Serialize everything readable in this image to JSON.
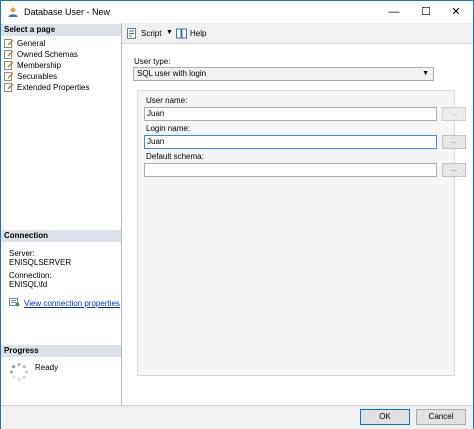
{
  "window": {
    "title": "Database User - New",
    "minimize_glyph": "—",
    "maximize_glyph": "☐",
    "close_glyph": "✕"
  },
  "toolbar": {
    "script_label": "Script",
    "help_label": "Help",
    "dropdown_glyph": "▼"
  },
  "left_pane": {
    "select_page_header": "Select a page",
    "pages": [
      {
        "label": "General",
        "icon": "page-wrench-icon"
      },
      {
        "label": "Owned Schemas",
        "icon": "page-wrench-icon"
      },
      {
        "label": "Membership",
        "icon": "page-wrench-icon"
      },
      {
        "label": "Securables",
        "icon": "page-wrench-icon"
      },
      {
        "label": "Extended Properties",
        "icon": "page-wrench-icon"
      }
    ],
    "connection_header": "Connection",
    "server_label": "Server:",
    "server_value": "ENISQLSERVER",
    "connection_label": "Connection:",
    "connection_value": "ENISQL\\fd",
    "view_connection_link": "View connection properties",
    "progress_header": "Progress",
    "progress_status": "Ready"
  },
  "form": {
    "user_type_label": "User type:",
    "user_type_value": "SQL user with login",
    "dropdown_glyph": "▼",
    "user_name_label": "User name:",
    "user_name_value": "Juan",
    "login_name_label": "Login name:",
    "login_name_value": "Juan",
    "default_schema_label": "Default schema:",
    "default_schema_value": "",
    "browse_label": "..."
  },
  "footer": {
    "ok_label": "OK",
    "cancel_label": "Cancel"
  },
  "colors": {
    "accent": "#0078d7",
    "link": "#0033cc",
    "section_header_bg": "#dde1ea"
  }
}
